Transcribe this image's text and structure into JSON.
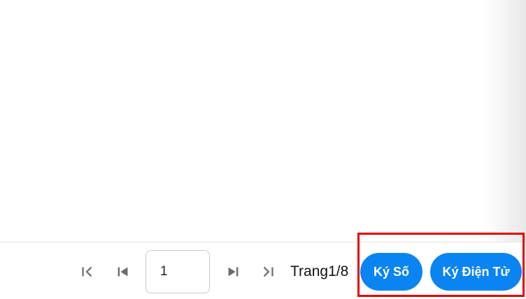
{
  "pager": {
    "first_icon": "first-page-icon",
    "prev_icon": "previous-page-icon",
    "next_icon": "next-page-icon",
    "last_icon": "last-page-icon",
    "current_page_value": "1",
    "page_label": "Trang1/8"
  },
  "actions": {
    "digital_sign_label": "Ký Số",
    "electronic_sign_label": "Ký Điện Tử"
  },
  "colors": {
    "button_blue": "#0a84f0",
    "highlight_red": "#e40000",
    "icon_gray": "#6b6b6b"
  }
}
